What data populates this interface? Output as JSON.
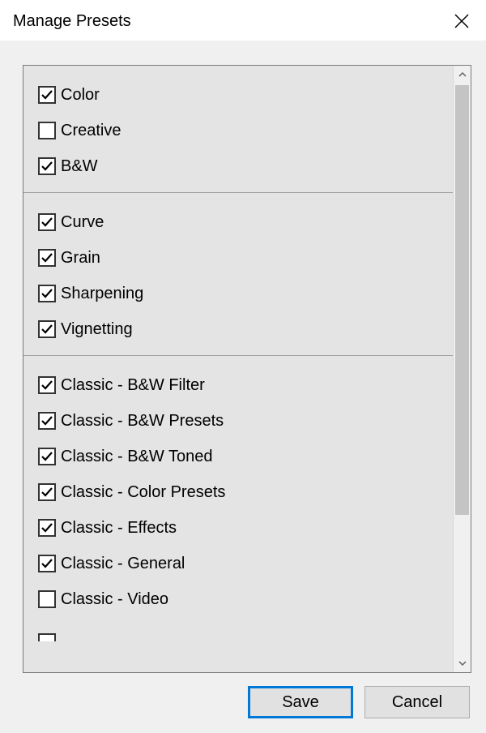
{
  "titlebar": {
    "title": "Manage Presets"
  },
  "groups": [
    {
      "items": [
        {
          "label": "Color",
          "checked": true
        },
        {
          "label": "Creative",
          "checked": false
        },
        {
          "label": "B&W",
          "checked": true
        }
      ]
    },
    {
      "items": [
        {
          "label": "Curve",
          "checked": true
        },
        {
          "label": "Grain",
          "checked": true
        },
        {
          "label": "Sharpening",
          "checked": true
        },
        {
          "label": "Vignetting",
          "checked": true
        }
      ]
    },
    {
      "items": [
        {
          "label": "Classic - B&W Filter",
          "checked": true
        },
        {
          "label": "Classic - B&W Presets",
          "checked": true
        },
        {
          "label": "Classic - B&W Toned",
          "checked": true
        },
        {
          "label": "Classic - Color Presets",
          "checked": true
        },
        {
          "label": "Classic - Effects",
          "checked": true
        },
        {
          "label": "Classic - General",
          "checked": true
        },
        {
          "label": "Classic - Video",
          "checked": false
        }
      ]
    }
  ],
  "buttons": {
    "save": "Save",
    "cancel": "Cancel"
  }
}
